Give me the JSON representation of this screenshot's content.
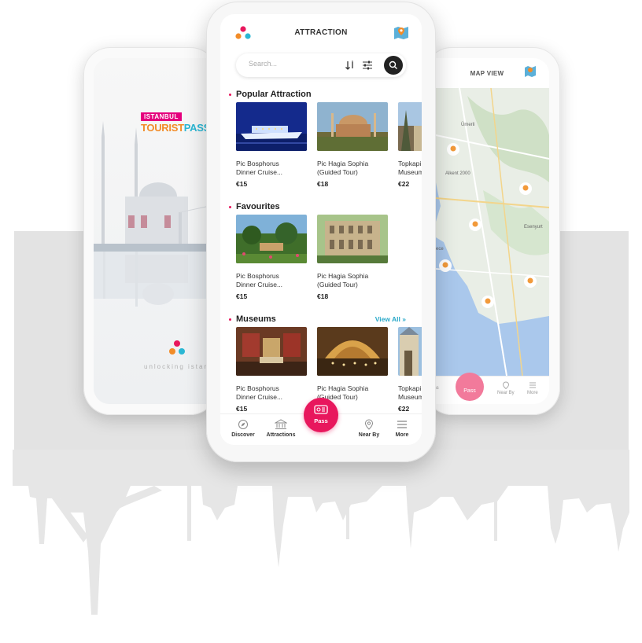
{
  "left_phone": {
    "logo_top": "ISTANBUL",
    "logo_main_a": "TOURIST",
    "logo_main_b": "PASS",
    "tagline": "unlocking istanbul"
  },
  "center_phone": {
    "title": "ATTRACTION",
    "search_placeholder": "Search...",
    "sections": [
      {
        "title": "Popular Attraction",
        "cards": [
          {
            "name": "Pic Bosphorus\nDinner Cruise...",
            "price": "€15"
          },
          {
            "name": "Pic Hagia Sophia\n(Guided Tour)",
            "price": "€18"
          },
          {
            "name": "Topkapi\nMuseum",
            "price": "€22"
          }
        ]
      },
      {
        "title": "Favourites",
        "cards": [
          {
            "name": "Pic Bosphorus\nDinner Cruise...",
            "price": "€15"
          },
          {
            "name": "Pic Hagia Sophia\n(Guided Tour)",
            "price": "€18"
          }
        ]
      },
      {
        "title": "Museums",
        "view_all": "View All »",
        "cards": [
          {
            "name": "Pic Bosphorus\nDinner Cruise...",
            "price": "€15"
          },
          {
            "name": "Pic Hagia Sophia\n(Guided Tour)",
            "price": "€18"
          },
          {
            "name": "Topkapi\nMuseum",
            "price": "€22"
          }
        ]
      }
    ],
    "tabs": {
      "discover": "Discover",
      "attractions": "Attractions",
      "pass": "Pass",
      "nearby": "Near By",
      "more": "More"
    }
  },
  "right_phone": {
    "title": "MAP VIEW",
    "map_labels": [
      "Ümerli",
      "Alkent 2000",
      "Esenyurt",
      "ece"
    ],
    "tabs": {
      "attractions": "ctions",
      "pass": "Pass",
      "nearby": "Near By",
      "more": "More"
    }
  },
  "colors": {
    "accent": "#e8175d",
    "link": "#2aa9c9",
    "logo_orange": "#f28c28",
    "logo_blue": "#2bb7d4"
  }
}
